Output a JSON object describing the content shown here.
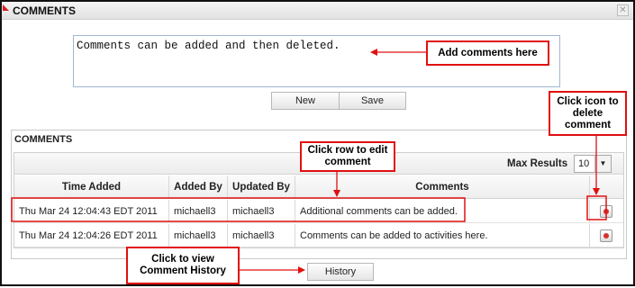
{
  "window": {
    "title": "COMMENTS",
    "close_glyph": "✕"
  },
  "editor": {
    "value": "Comments can be added and then deleted.",
    "buttons": {
      "new_label": "New",
      "save_label": "Save"
    }
  },
  "panel": {
    "title": "COMMENTS",
    "max_results_label": "Max Results",
    "max_results_value": "10",
    "columns": [
      "Time Added",
      "Added By",
      "Updated By",
      "Comments"
    ],
    "rows": [
      {
        "time_added": "Thu Mar 24 12:04:43 EDT 2011",
        "added_by": "michaell3",
        "updated_by": "michaell3",
        "comment": "Additional comments can be added."
      },
      {
        "time_added": "Thu Mar 24 12:04:26 EDT 2011",
        "added_by": "michaell3",
        "updated_by": "michaell3",
        "comment": "Comments can be added to activities here."
      }
    ],
    "history_label": "History"
  },
  "callouts": {
    "add_comments": "Add comments here",
    "delete_icon": "Click icon to delete comment",
    "edit_row": "Click row to edit comment",
    "view_history": "Click to view Comment History"
  },
  "colors": {
    "callout_border": "#e01010",
    "input_border": "#9fb7d2"
  }
}
